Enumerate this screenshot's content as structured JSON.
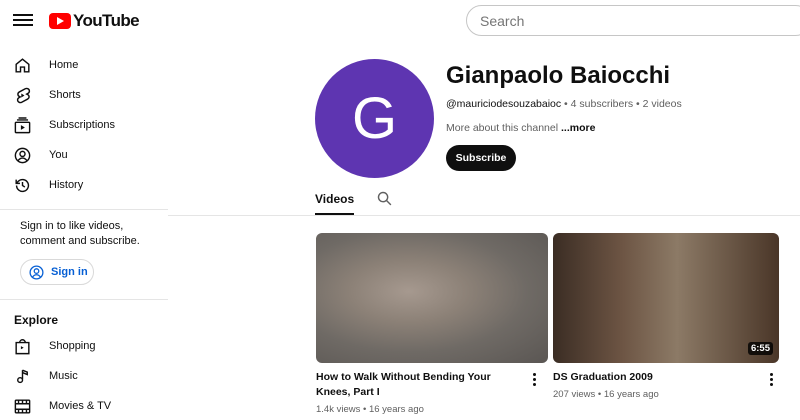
{
  "header": {
    "logo_text": "YouTube",
    "search_placeholder": "Search"
  },
  "sidebar": {
    "items": [
      {
        "label": "Home",
        "icon": "home-icon"
      },
      {
        "label": "Shorts",
        "icon": "shorts-icon"
      },
      {
        "label": "Subscriptions",
        "icon": "subscriptions-icon"
      },
      {
        "label": "You",
        "icon": "you-icon"
      },
      {
        "label": "History",
        "icon": "history-icon"
      }
    ],
    "signin_text": "Sign in to like videos, comment and subscribe.",
    "signin_button": "Sign in",
    "explore_heading": "Explore",
    "explore_items": [
      {
        "label": "Shopping",
        "icon": "shopping-icon"
      },
      {
        "label": "Music",
        "icon": "music-icon"
      },
      {
        "label": "Movies & TV",
        "icon": "movies-icon"
      }
    ]
  },
  "channel": {
    "avatar_letter": "G",
    "avatar_color": "#5e35b1",
    "name": "Gianpaolo Baiocchi",
    "handle": "@mauriciodesouzabaioc",
    "subscribers": "4 subscribers",
    "videos_count": "2 videos",
    "meta_separator": " • ",
    "about_text": "More about this channel",
    "about_more": "...more",
    "subscribe_label": "Subscribe"
  },
  "tabs": {
    "videos": "Videos"
  },
  "videos": [
    {
      "title": "How to Walk Without Bending Your Knees, Part I",
      "views": "1.4k views",
      "age": "16 years ago",
      "duration": ""
    },
    {
      "title": "DS Graduation 2009",
      "views": "207 views",
      "age": "16 years ago",
      "duration": "6:55"
    }
  ],
  "colors": {
    "brand_red": "#ff0000",
    "link_blue": "#065fd4",
    "text_primary": "#0f0f0f",
    "text_secondary": "#606060"
  }
}
